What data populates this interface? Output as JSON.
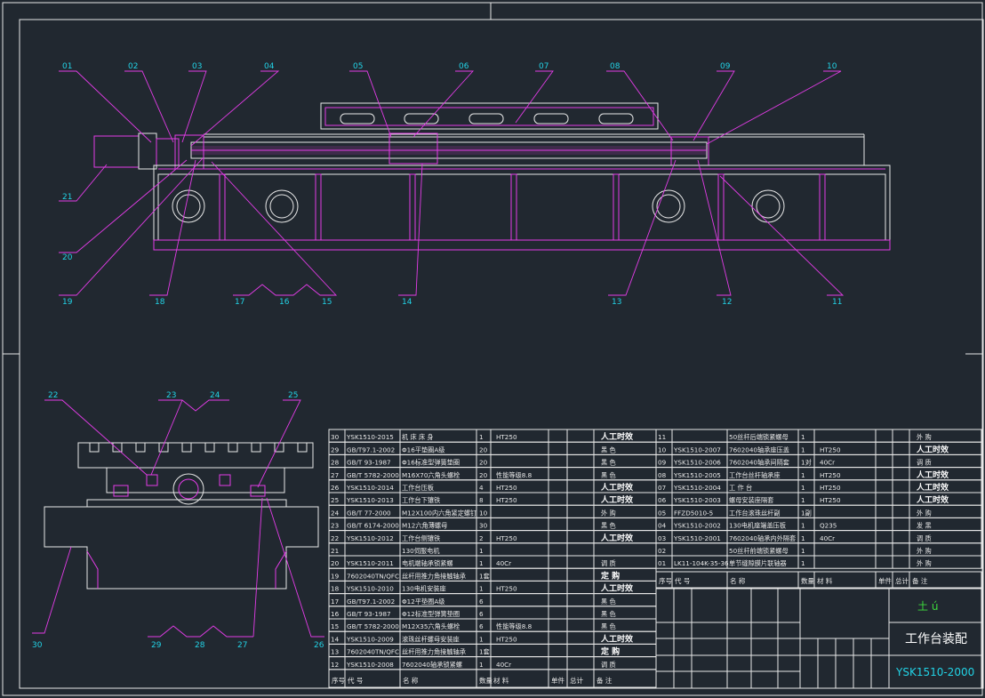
{
  "drawing": {
    "title": "工作台装配",
    "code": "YSK1510-2000",
    "logo": "土 ú"
  },
  "callouts": {
    "top": [
      "01",
      "02",
      "03",
      "04",
      "05",
      "06",
      "07",
      "08",
      "09",
      "10"
    ],
    "bottom": [
      "21",
      "20",
      "19",
      "18",
      "17",
      "16",
      "15",
      "14",
      "13",
      "12",
      "11"
    ],
    "section_top": [
      "22",
      "23",
      "24",
      "25"
    ],
    "section_bottom": [
      "30",
      "29",
      "28",
      "27",
      "26"
    ]
  },
  "bom_left_rows": [
    {
      "no": "30",
      "code": "YSK1510-2015",
      "name": "机 床 床 身",
      "qty": "1",
      "mat": "HT250",
      "note": "人工时效"
    },
    {
      "no": "29",
      "code": "GB/T97.1-2002",
      "name": "Φ16平垫圈A级",
      "qty": "20",
      "mat": "",
      "note": "黑  色"
    },
    {
      "no": "28",
      "code": "GB/T 93-1987",
      "name": "Φ16标准型弹簧垫圈",
      "qty": "20",
      "mat": "",
      "note": "黑  色"
    },
    {
      "no": "27",
      "code": "GB/T 5782-2000",
      "name": "M16X70六角头螺栓",
      "qty": "20",
      "mat": "性能等级8.8",
      "note": "黑  色"
    },
    {
      "no": "26",
      "code": "YSK1510-2014",
      "name": "工作台压板",
      "qty": "4",
      "mat": "HT250",
      "note": "人工时效"
    },
    {
      "no": "25",
      "code": "YSK1510-2013",
      "name": "工作台下镶铁",
      "qty": "8",
      "mat": "HT250",
      "note": "人工时效"
    },
    {
      "no": "24",
      "code": "GB/T 77-2000",
      "name": "M12X100内六角紧定螺钉",
      "qty": "10",
      "mat": "",
      "note": "外  购"
    },
    {
      "no": "23",
      "code": "GB/T 6174-2000",
      "name": "M12六角薄螺母",
      "qty": "30",
      "mat": "",
      "note": "黑  色"
    },
    {
      "no": "22",
      "code": "YSK1510-2012",
      "name": "工作台侧镶铁",
      "qty": "2",
      "mat": "HT250",
      "note": "人工时效"
    },
    {
      "no": "21",
      "code": "",
      "name": "130伺服电机",
      "qty": "1",
      "mat": "",
      "note": ""
    },
    {
      "no": "20",
      "code": "YSK1510-2011",
      "name": "电机端轴承锁紧螺",
      "qty": "1",
      "mat": "40Cr",
      "note": "调  质"
    },
    {
      "no": "19",
      "code": "7602040TN/QFC",
      "name": "丝杆用推力角接触轴承",
      "qty": "1套",
      "mat": "",
      "note": "定  购"
    },
    {
      "no": "18",
      "code": "YSK1510-2010",
      "name": "130电机安装座",
      "qty": "1",
      "mat": "HT250",
      "note": "人工时效"
    },
    {
      "no": "17",
      "code": "GB/T97.1-2002",
      "name": "Φ12平垫圈A级",
      "qty": "6",
      "mat": "",
      "note": "黑  色"
    },
    {
      "no": "16",
      "code": "GB/T 93-1987",
      "name": "Φ12标准型弹簧垫圈",
      "qty": "6",
      "mat": "",
      "note": "黑  色"
    },
    {
      "no": "15",
      "code": "GB/T 5782-2000",
      "name": "M12X35六角头螺栓",
      "qty": "6",
      "mat": "性能等级8.8",
      "note": "黑  色"
    },
    {
      "no": "14",
      "code": "YSK1510-2009",
      "name": "滚珠丝杆螺母安装座",
      "qty": "1",
      "mat": "HT250",
      "note": "人工时效"
    },
    {
      "no": "13",
      "code": "7602040TN/QFC",
      "name": "丝杆用推力角接触轴承",
      "qty": "1套",
      "mat": "",
      "note": "定  购"
    },
    {
      "no": "12",
      "code": "YSK1510-2008",
      "name": "7602040轴承锁紧螺",
      "qty": "1",
      "mat": "40Cr",
      "note": "调  质"
    }
  ],
  "bom_right_rows": [
    {
      "no": "11",
      "code": "",
      "name": "50丝杆后端锁紧螺母",
      "qty": "1",
      "mat": "",
      "note": "外  购"
    },
    {
      "no": "10",
      "code": "YSK1510-2007",
      "name": "7602040轴承座压盖",
      "qty": "1",
      "mat": "HT250",
      "note": "人工时效"
    },
    {
      "no": "09",
      "code": "YSK1510-2006",
      "name": "7602040轴承间隔套",
      "qty": "1对",
      "mat": "40Cr",
      "note": "调  质"
    },
    {
      "no": "08",
      "code": "YSK1510-2005",
      "name": "工作台丝杆轴承座",
      "qty": "1",
      "mat": "HT250",
      "note": "人工时效"
    },
    {
      "no": "07",
      "code": "YSK1510-2004",
      "name": "工  作  台",
      "qty": "1",
      "mat": "HT250",
      "note": "人工时效"
    },
    {
      "no": "06",
      "code": "YSK1510-2003",
      "name": "螺母安装座隔套",
      "qty": "1",
      "mat": "HT250",
      "note": "人工时效"
    },
    {
      "no": "05",
      "code": "FFZD5010-5",
      "name": "工作台滚珠丝杆副",
      "qty": "1副",
      "mat": "",
      "note": "外  购"
    },
    {
      "no": "04",
      "code": "YSK1510-2002",
      "name": "130电机座端盖压板",
      "qty": "1",
      "mat": "Q235",
      "note": "发  黑"
    },
    {
      "no": "03",
      "code": "YSK1510-2001",
      "name": "7602040轴承内外隔套",
      "qty": "1",
      "mat": "40Cr",
      "note": "调  质"
    },
    {
      "no": "02",
      "code": "",
      "name": "50丝杆前端锁紧螺母",
      "qty": "1",
      "mat": "",
      "note": "外  购"
    },
    {
      "no": "01",
      "code": "LK11-104K-35-36",
      "name": "单节缝隙膜片联轴器",
      "qty": "1",
      "mat": "",
      "note": "外  购"
    }
  ],
  "bom_header": {
    "no": "序号",
    "code": "代  号",
    "name": "名  称",
    "qty": "数量",
    "mat": "材  料",
    "w1": "单件",
    "w2": "总计",
    "weight": "重量",
    "note": "备  注"
  },
  "colors": {
    "background": "#212830",
    "line": "#e8e8e8",
    "section": "#e23ce6",
    "callout": "#22d3e6",
    "red_note": "#ff3b3b"
  }
}
